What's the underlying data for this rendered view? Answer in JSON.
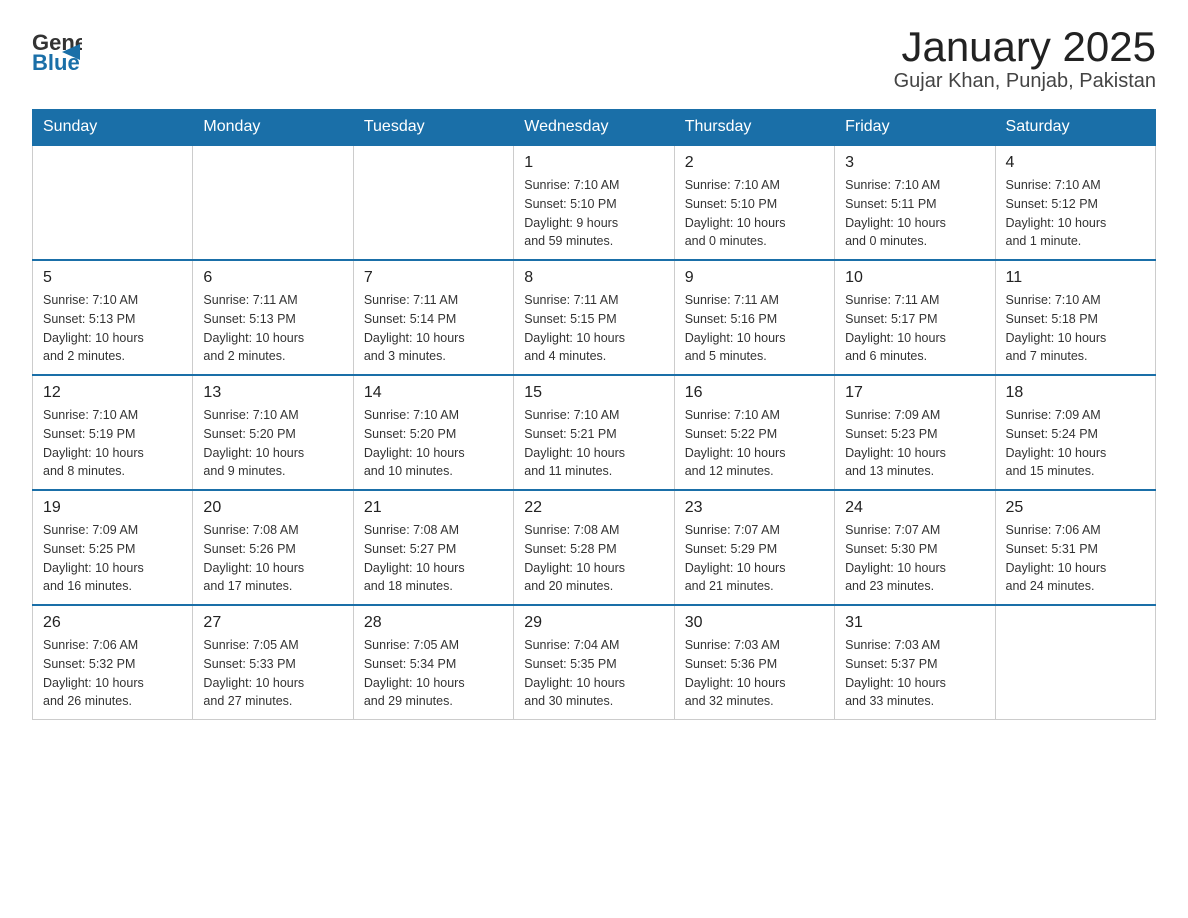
{
  "header": {
    "logo": {
      "general": "General",
      "blue": "Blue"
    },
    "title": "January 2025",
    "subtitle": "Gujar Khan, Punjab, Pakistan"
  },
  "calendar": {
    "days_of_week": [
      "Sunday",
      "Monday",
      "Tuesday",
      "Wednesday",
      "Thursday",
      "Friday",
      "Saturday"
    ],
    "weeks": [
      [
        {
          "day": "",
          "info": ""
        },
        {
          "day": "",
          "info": ""
        },
        {
          "day": "",
          "info": ""
        },
        {
          "day": "1",
          "info": "Sunrise: 7:10 AM\nSunset: 5:10 PM\nDaylight: 9 hours\nand 59 minutes."
        },
        {
          "day": "2",
          "info": "Sunrise: 7:10 AM\nSunset: 5:10 PM\nDaylight: 10 hours\nand 0 minutes."
        },
        {
          "day": "3",
          "info": "Sunrise: 7:10 AM\nSunset: 5:11 PM\nDaylight: 10 hours\nand 0 minutes."
        },
        {
          "day": "4",
          "info": "Sunrise: 7:10 AM\nSunset: 5:12 PM\nDaylight: 10 hours\nand 1 minute."
        }
      ],
      [
        {
          "day": "5",
          "info": "Sunrise: 7:10 AM\nSunset: 5:13 PM\nDaylight: 10 hours\nand 2 minutes."
        },
        {
          "day": "6",
          "info": "Sunrise: 7:11 AM\nSunset: 5:13 PM\nDaylight: 10 hours\nand 2 minutes."
        },
        {
          "day": "7",
          "info": "Sunrise: 7:11 AM\nSunset: 5:14 PM\nDaylight: 10 hours\nand 3 minutes."
        },
        {
          "day": "8",
          "info": "Sunrise: 7:11 AM\nSunset: 5:15 PM\nDaylight: 10 hours\nand 4 minutes."
        },
        {
          "day": "9",
          "info": "Sunrise: 7:11 AM\nSunset: 5:16 PM\nDaylight: 10 hours\nand 5 minutes."
        },
        {
          "day": "10",
          "info": "Sunrise: 7:11 AM\nSunset: 5:17 PM\nDaylight: 10 hours\nand 6 minutes."
        },
        {
          "day": "11",
          "info": "Sunrise: 7:10 AM\nSunset: 5:18 PM\nDaylight: 10 hours\nand 7 minutes."
        }
      ],
      [
        {
          "day": "12",
          "info": "Sunrise: 7:10 AM\nSunset: 5:19 PM\nDaylight: 10 hours\nand 8 minutes."
        },
        {
          "day": "13",
          "info": "Sunrise: 7:10 AM\nSunset: 5:20 PM\nDaylight: 10 hours\nand 9 minutes."
        },
        {
          "day": "14",
          "info": "Sunrise: 7:10 AM\nSunset: 5:20 PM\nDaylight: 10 hours\nand 10 minutes."
        },
        {
          "day": "15",
          "info": "Sunrise: 7:10 AM\nSunset: 5:21 PM\nDaylight: 10 hours\nand 11 minutes."
        },
        {
          "day": "16",
          "info": "Sunrise: 7:10 AM\nSunset: 5:22 PM\nDaylight: 10 hours\nand 12 minutes."
        },
        {
          "day": "17",
          "info": "Sunrise: 7:09 AM\nSunset: 5:23 PM\nDaylight: 10 hours\nand 13 minutes."
        },
        {
          "day": "18",
          "info": "Sunrise: 7:09 AM\nSunset: 5:24 PM\nDaylight: 10 hours\nand 15 minutes."
        }
      ],
      [
        {
          "day": "19",
          "info": "Sunrise: 7:09 AM\nSunset: 5:25 PM\nDaylight: 10 hours\nand 16 minutes."
        },
        {
          "day": "20",
          "info": "Sunrise: 7:08 AM\nSunset: 5:26 PM\nDaylight: 10 hours\nand 17 minutes."
        },
        {
          "day": "21",
          "info": "Sunrise: 7:08 AM\nSunset: 5:27 PM\nDaylight: 10 hours\nand 18 minutes."
        },
        {
          "day": "22",
          "info": "Sunrise: 7:08 AM\nSunset: 5:28 PM\nDaylight: 10 hours\nand 20 minutes."
        },
        {
          "day": "23",
          "info": "Sunrise: 7:07 AM\nSunset: 5:29 PM\nDaylight: 10 hours\nand 21 minutes."
        },
        {
          "day": "24",
          "info": "Sunrise: 7:07 AM\nSunset: 5:30 PM\nDaylight: 10 hours\nand 23 minutes."
        },
        {
          "day": "25",
          "info": "Sunrise: 7:06 AM\nSunset: 5:31 PM\nDaylight: 10 hours\nand 24 minutes."
        }
      ],
      [
        {
          "day": "26",
          "info": "Sunrise: 7:06 AM\nSunset: 5:32 PM\nDaylight: 10 hours\nand 26 minutes."
        },
        {
          "day": "27",
          "info": "Sunrise: 7:05 AM\nSunset: 5:33 PM\nDaylight: 10 hours\nand 27 minutes."
        },
        {
          "day": "28",
          "info": "Sunrise: 7:05 AM\nSunset: 5:34 PM\nDaylight: 10 hours\nand 29 minutes."
        },
        {
          "day": "29",
          "info": "Sunrise: 7:04 AM\nSunset: 5:35 PM\nDaylight: 10 hours\nand 30 minutes."
        },
        {
          "day": "30",
          "info": "Sunrise: 7:03 AM\nSunset: 5:36 PM\nDaylight: 10 hours\nand 32 minutes."
        },
        {
          "day": "31",
          "info": "Sunrise: 7:03 AM\nSunset: 5:37 PM\nDaylight: 10 hours\nand 33 minutes."
        },
        {
          "day": "",
          "info": ""
        }
      ]
    ]
  }
}
